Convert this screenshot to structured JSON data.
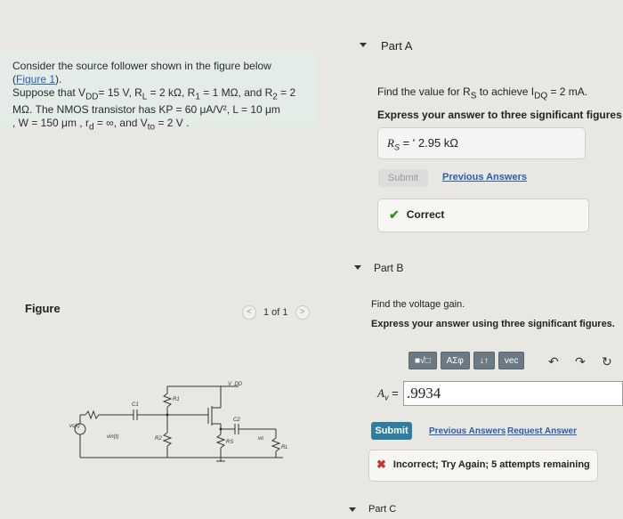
{
  "problem": {
    "line1_a": "Consider the source follower shown in the figure below (",
    "figure_link": "Figure 1",
    "line1_b": ").",
    "line2": "Suppose that V",
    "line2_sub": "DD",
    "line2_b": "= 15 V, R",
    "line2_c": "L",
    "line2_d": " = 2 kΩ, R",
    "line2_e": "1",
    "line2_f": " = 1 MΩ, and R",
    "line2_g": "2",
    "line2_h": " = 2",
    "line3": "MΩ. The NMOS transistor has KP = 60 μA/V², L = 10 μm",
    "line4": ", W = 150 μm , r",
    "line4_sub": "d",
    "line4_b": " = ∞, and V",
    "line4_sub2": "to",
    "line4_c": " = 2 V ."
  },
  "figure": {
    "label": "Figure",
    "pager": "1 of 1",
    "prev": "<",
    "next": ">"
  },
  "partA": {
    "title": "Part A",
    "prompt_a": "Find the value for R",
    "prompt_sub1": "S",
    "prompt_b": " to achieve I",
    "prompt_sub2": "DQ",
    "prompt_c": " = 2 mA.",
    "instruction": "Express your answer to three significant figures and",
    "answer_var": "R",
    "answer_sub": "S",
    "answer_value": " = ʹ 2.95 kΩ",
    "submit": "Submit",
    "previous_answers": "Previous Answers",
    "feedback": "Correct"
  },
  "partB": {
    "title": "Part B",
    "prompt": "Find the voltage gain.",
    "instruction": "Express your answer using three significant figures.",
    "toolbar": [
      "■√□",
      "ΑΣφ",
      "↓↑",
      "vec"
    ],
    "av_label": "A",
    "av_sub": "v",
    "av_eq": " =",
    "av_value": ".9934",
    "submit": "Submit",
    "previous_answers": "Previous Answers",
    "request_answer": "Request Answer",
    "feedback": "Incorrect; Try Again; 5 attempts remaining"
  },
  "partC": {
    "title": "Part C"
  },
  "circuit": {
    "vdd": "V_DD",
    "r1": "R1",
    "r2": "R2",
    "rs": "RS",
    "rl": "RL",
    "c1": "C1",
    "c2": "C2",
    "vs": "vs(t)",
    "vin": "vin(t)",
    "vo": "vo"
  },
  "colors": {
    "link": "#2a5db0",
    "correct": "#3d8a2e",
    "incorrect": "#c0392b",
    "submit_bg": "#2f7d9f",
    "problem_bg": "#e4ece8"
  }
}
